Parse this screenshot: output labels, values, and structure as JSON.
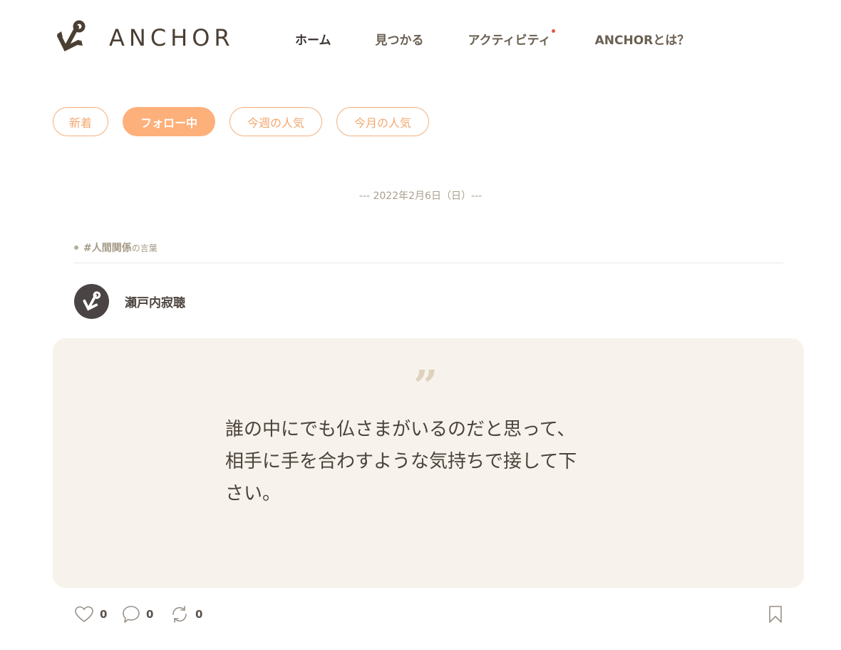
{
  "brand": {
    "name": "ANCHOR",
    "logo_icon": "anchor-icon"
  },
  "nav": {
    "items": [
      {
        "label": "ホーム",
        "active": true
      },
      {
        "label": "見つかる",
        "active": false
      },
      {
        "label": "アクティビティ",
        "active": false,
        "has_notification": true
      },
      {
        "label": "ANCHORとは？",
        "active": false
      }
    ]
  },
  "tabs": [
    {
      "label": "新着",
      "active": false
    },
    {
      "label": "フォロー中",
      "active": true
    },
    {
      "label": "今週の人気",
      "active": false
    },
    {
      "label": "今月の人気",
      "active": false
    }
  ],
  "feed": {
    "date_label": "--- 2022年2月6日（日）---",
    "post": {
      "tag": "#人間関係",
      "tag_suffix": "の言葉",
      "author": "瀬戸内寂聴",
      "quote_mark": "”",
      "quote_lines": [
        "誰の中にでも仏さまがいるのだと思って、",
        "相手に手を合わすような気持ちで接して下",
        "さい。"
      ],
      "likes": "0",
      "comments": "0",
      "reposts": "0"
    }
  },
  "colors": {
    "accent": "#fdb07a",
    "card_bg": "#f7f3ec",
    "notification": "#e05a4a",
    "brand_dark": "#4a3f33"
  }
}
